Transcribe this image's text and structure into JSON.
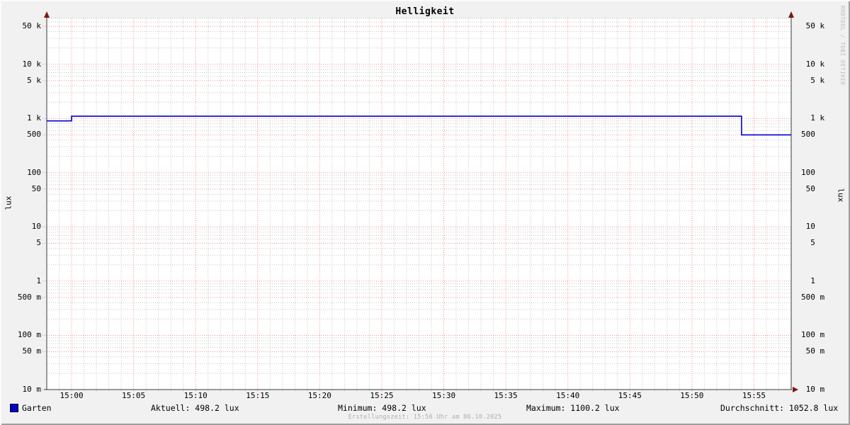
{
  "title": "Helligkeit",
  "watermark": "RRDTOOL / TOBI OETIKER",
  "axis": {
    "y_label_left": "lux",
    "y_label_right": "lux"
  },
  "chart_data": {
    "type": "line",
    "line_style": "step",
    "title": "Helligkeit",
    "ylabel": "lux",
    "y_scale": "log",
    "y_range": [
      0.01,
      70000
    ],
    "x_range": [
      "14:58",
      "15:58"
    ],
    "grid": "on",
    "x_major_ticks": [
      "15:00",
      "15:05",
      "15:10",
      "15:15",
      "15:20",
      "15:25",
      "15:30",
      "15:35",
      "15:40",
      "15:45",
      "15:50",
      "15:55"
    ],
    "x_minor_step_minutes": 1,
    "y_major_ticks": [
      {
        "value": 50000,
        "label": "50 k"
      },
      {
        "value": 10000,
        "label": "10 k"
      },
      {
        "value": 5000,
        "label": "5 k"
      },
      {
        "value": 1000,
        "label": "1 k"
      },
      {
        "value": 500,
        "label": "500"
      },
      {
        "value": 100,
        "label": "100"
      },
      {
        "value": 50,
        "label": "50"
      },
      {
        "value": 10,
        "label": "10"
      },
      {
        "value": 5,
        "label": "5"
      },
      {
        "value": 1,
        "label": "1"
      },
      {
        "value": 0.5,
        "label": "500 m"
      },
      {
        "value": 0.1,
        "label": "100 m"
      },
      {
        "value": 0.05,
        "label": "50 m"
      },
      {
        "value": 0.01,
        "label": "10 m"
      }
    ],
    "series": [
      {
        "name": "Garten",
        "color": "#0000cc",
        "step_points": [
          {
            "time": "14:58",
            "value": 900
          },
          {
            "time": "15:00",
            "value": 1100.2
          },
          {
            "time": "15:54",
            "value": 498.2
          }
        ],
        "end_time": "15:58"
      }
    ],
    "stats": {
      "aktuell": "498.2 lux",
      "minimum": "498.2 lux",
      "maximum": "1100.2 lux",
      "durchschnitt": "1052.8 lux"
    }
  },
  "legend": {
    "series_label": "Garten",
    "swatch_color": "#0000cc",
    "stats": [
      {
        "text": "Aktuell: 498.2 lux"
      },
      {
        "text": "Minimum: 498.2 lux"
      },
      {
        "text": "Maximum: 1100.2 lux"
      },
      {
        "text": "Durchschnitt: 1052.8 lux"
      }
    ]
  },
  "footer": {
    "creation_time": "Erstellungszeit: 15:58 Uhr am 06.10.2025"
  },
  "colors": {
    "background": "#f1f1f1",
    "canvas": "#ffffff",
    "axis": "#3b3b3b",
    "arrow": "#7c1616",
    "major_grid": "#ff0000",
    "minor_grid": "#787878",
    "line": "#0000cc"
  }
}
